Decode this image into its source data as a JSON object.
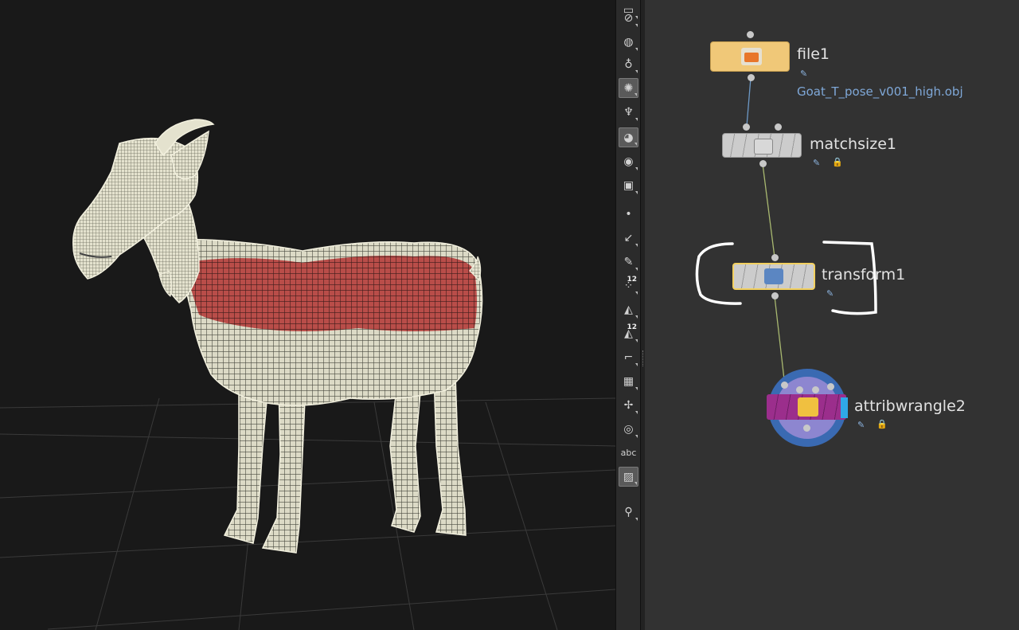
{
  "viewport": {
    "subject": "goat wireframe mesh",
    "mesh_color": "#e9e7d4",
    "highlight_color": "#8a1f1f",
    "background": "#191919"
  },
  "toolbar": {
    "tools": [
      {
        "icon": "select-icon"
      },
      {
        "icon": "no-icon"
      },
      {
        "icon": "globe-icon"
      },
      {
        "icon": "light-bulb-icon"
      },
      {
        "icon": "light-bulb-active-icon",
        "active": true
      },
      {
        "icon": "light-stand-icon"
      },
      {
        "icon": "sphere-shading-icon",
        "active": true
      },
      {
        "icon": "eye-icon"
      },
      {
        "icon": "camera-eye-icon"
      },
      {
        "icon": "point-icon"
      },
      {
        "icon": "normal-icon"
      },
      {
        "icon": "brush-icon"
      },
      {
        "icon": "point-numbers-icon",
        "badge": "12"
      },
      {
        "icon": "primitive-icon"
      },
      {
        "icon": "primitive-numbers-icon",
        "badge": "12"
      },
      {
        "icon": "curve-icon"
      },
      {
        "icon": "snap-grid-icon"
      },
      {
        "icon": "handle-icon"
      },
      {
        "icon": "circle-menu-icon"
      },
      {
        "icon": "text-abc-icon",
        "label": "abc"
      },
      {
        "icon": "background-image-icon",
        "active": true
      },
      {
        "icon": "pin-icon"
      }
    ]
  },
  "network": {
    "nodes": [
      {
        "id": "file1",
        "label": "file1",
        "path": "Goat_T_pose_v001_high.obj",
        "color": "#f0c878"
      },
      {
        "id": "matchsize1",
        "label": "matchsize1",
        "color": "#c9c9c9"
      },
      {
        "id": "transform1",
        "label": "transform1",
        "color": "#c9c9c9",
        "selected": true
      },
      {
        "id": "attribwrangle2",
        "label": "attribwrangle2",
        "color": "#9b2e8c"
      }
    ],
    "wire_color": "#a8b870",
    "selection_color": "#f2d060"
  }
}
